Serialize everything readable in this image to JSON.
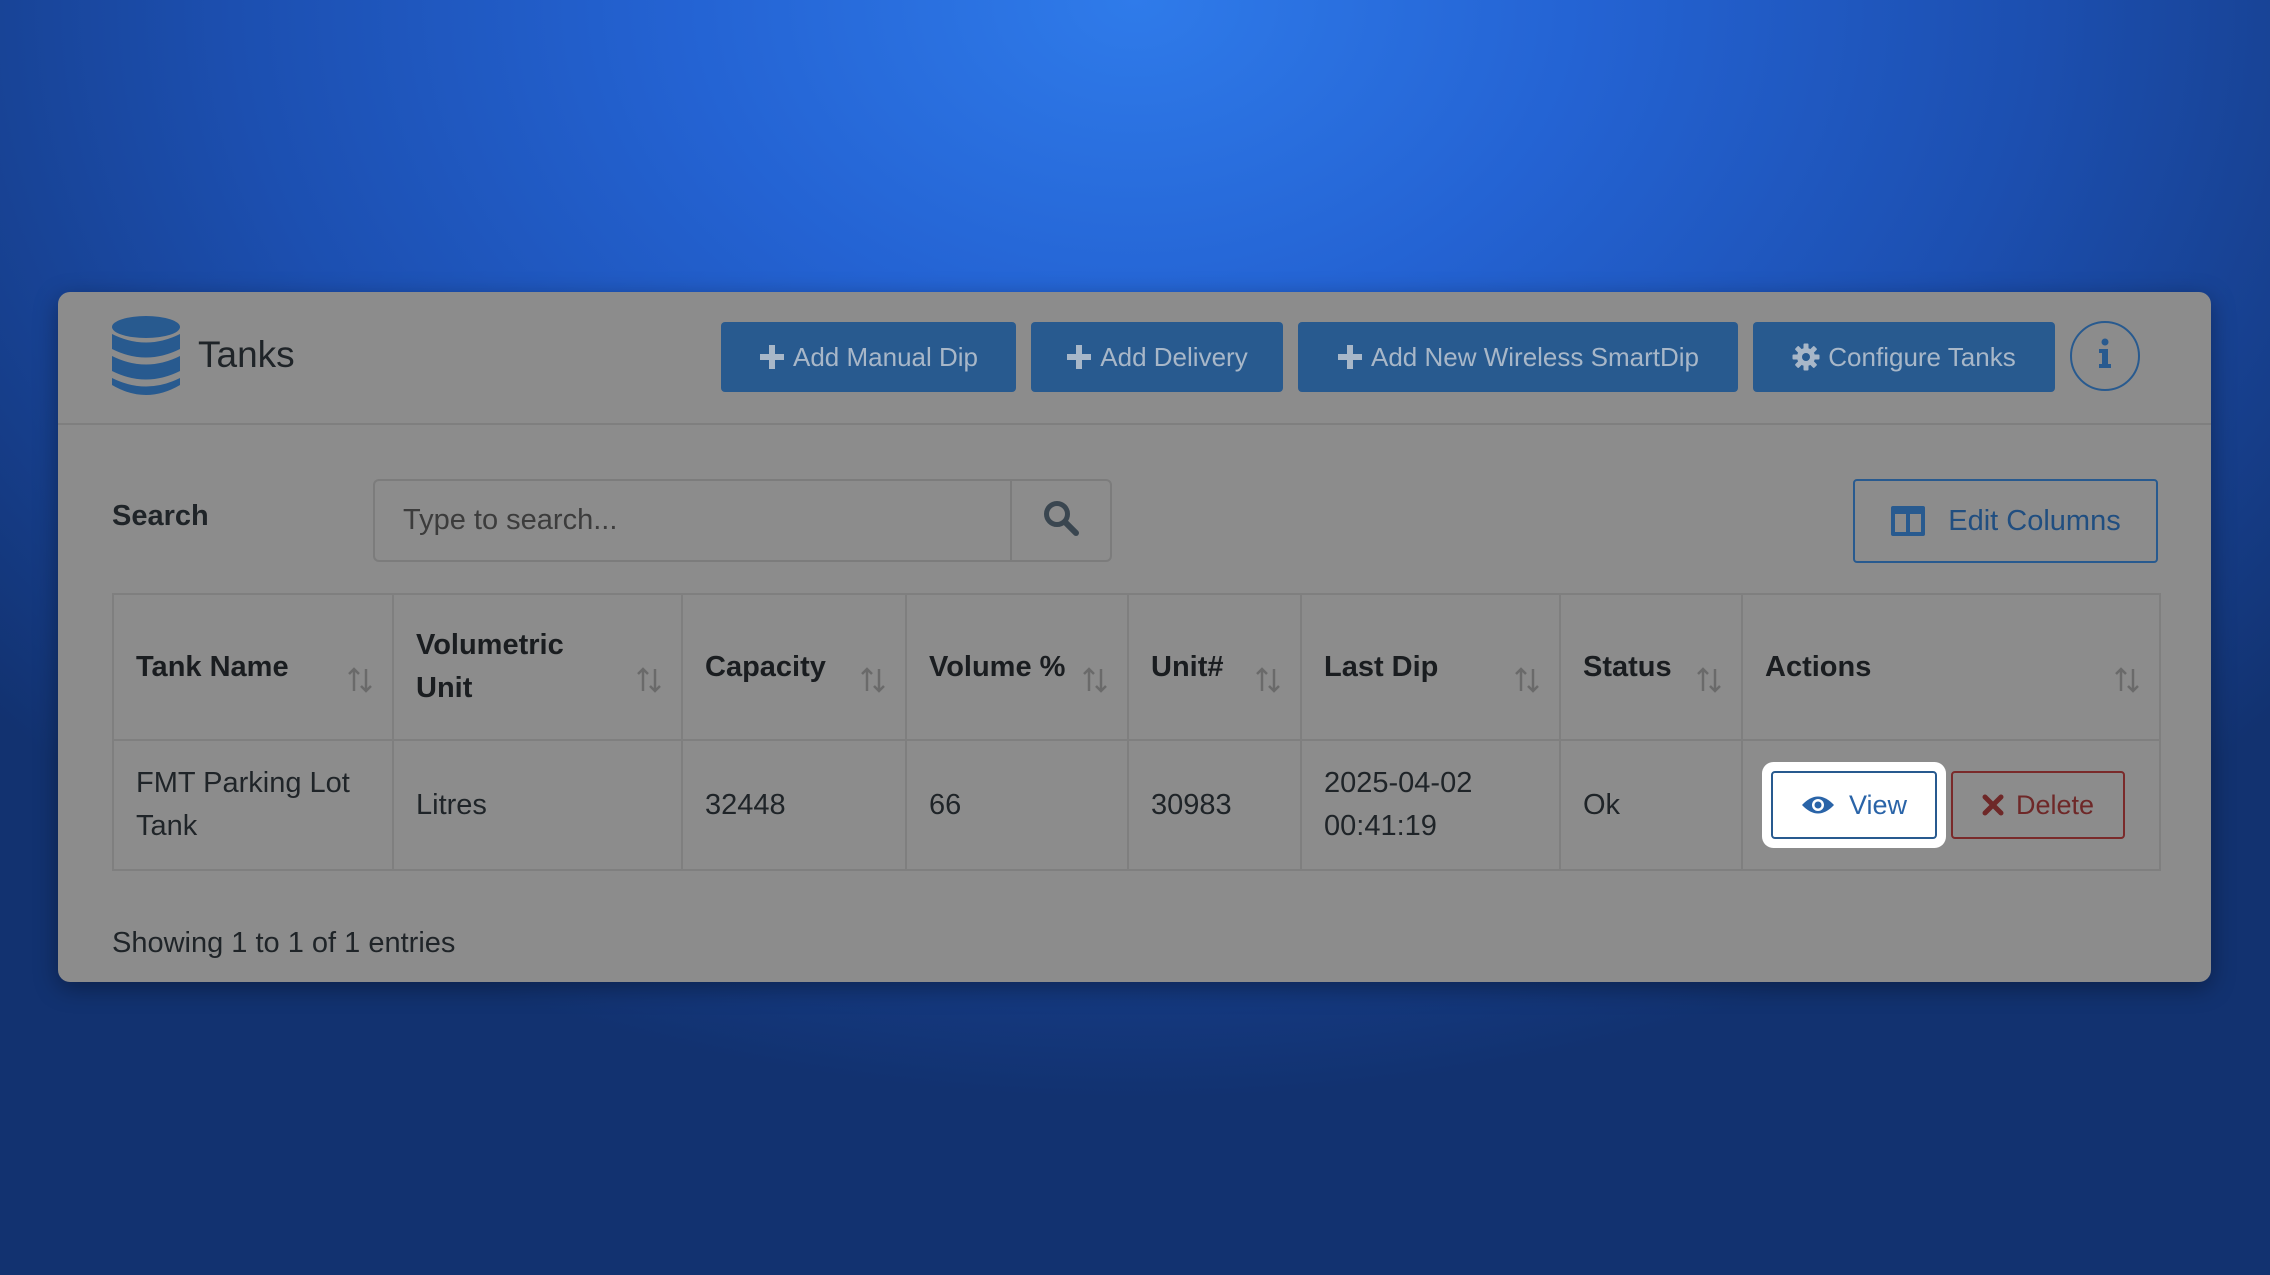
{
  "page": {
    "title": "Tanks",
    "icon": "database-icon"
  },
  "toolbar": {
    "add_manual_dip": "Add Manual Dip",
    "add_delivery": "Add Delivery",
    "add_smartdip": "Add New Wireless SmartDip",
    "configure_tanks": "Configure Tanks",
    "info_icon": "info-icon"
  },
  "search": {
    "label": "Search",
    "placeholder": "Type to search...",
    "value": ""
  },
  "edit_columns": {
    "label": "Edit Columns"
  },
  "table": {
    "columns": [
      "Tank Name",
      "Volumetric Unit",
      "Capacity",
      "Volume %",
      "Unit#",
      "Last Dip",
      "Status",
      "Actions"
    ],
    "rows": [
      {
        "tank_name": "FMT Parking Lot Tank",
        "volumetric_unit": "Litres",
        "capacity": "32448",
        "volume_pct": "66",
        "unit_no": "30983",
        "last_dip_date": "2025-04-02",
        "last_dip_time": "00:41:19",
        "status": "Ok",
        "view_label": "View",
        "delete_label": "Delete"
      }
    ]
  },
  "footer": {
    "entries_info": "Showing 1 to 1 of 1 entries"
  },
  "colors": {
    "primary": "#285a8f",
    "danger": "#7a2a2a",
    "card_overlay": "#8c8c8c"
  }
}
